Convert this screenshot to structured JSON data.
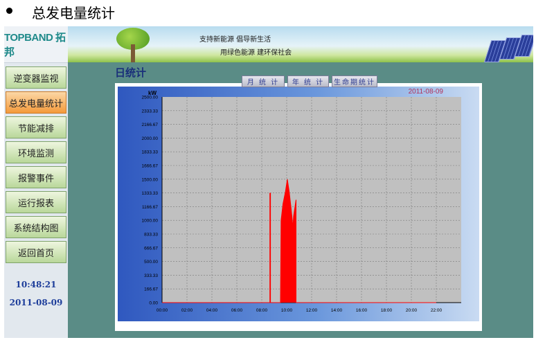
{
  "heading": {
    "bullet": "●",
    "text": "总发电量统计"
  },
  "logo": {
    "text": "TOPBAND 拓邦"
  },
  "banner": {
    "line1": "支持新能源   倡导新生活",
    "line2": "用绿色能源  建环保社会"
  },
  "nav": [
    {
      "label": "逆变器监视",
      "active": false
    },
    {
      "label": "总发电量统计",
      "active": true
    },
    {
      "label": "节能减排",
      "active": false
    },
    {
      "label": "环境监测",
      "active": false
    },
    {
      "label": "报警事件",
      "active": false
    },
    {
      "label": "运行报表",
      "active": false
    },
    {
      "label": "系统结构图",
      "active": false
    },
    {
      "label": "返回首页",
      "active": false
    }
  ],
  "clock": {
    "time": "10:48:21",
    "date": "2011-08-09"
  },
  "content": {
    "title": "日统计",
    "tabs": [
      "月 统 计",
      "年 统 计",
      "生命期统计"
    ],
    "chart_date": "2011-08-09"
  },
  "colors": {
    "series": "#ff0000",
    "plot_bg": "#c0c0c0",
    "grid": "#7a7a7a",
    "active_nav": "#f49a3b"
  },
  "chart_data": {
    "type": "area",
    "ylabel": "kW",
    "ylim": [
      0,
      2500
    ],
    "xlim": [
      0,
      24
    ],
    "y_ticks": [
      "2500.00",
      "2333.33",
      "2166.67",
      "2000.00",
      "1833.33",
      "1666.67",
      "1500.00",
      "1333.33",
      "1166.67",
      "1000.00",
      "833.33",
      "666.67",
      "500.00",
      "333.33",
      "166.67",
      "0.00"
    ],
    "x_ticks": [
      "00:00",
      "02:00",
      "04:00",
      "06:00",
      "08:00",
      "10:00",
      "12:00",
      "14:00",
      "16:00",
      "18:00",
      "20:00",
      "22:00"
    ],
    "grid": true,
    "series": [
      {
        "color": "#ff0000",
        "x": [
          0,
          8.65,
          8.65,
          8.7,
          8.7,
          9.5,
          9.55,
          9.7,
          9.9,
          10.05,
          10.2,
          10.35,
          10.45,
          10.5,
          10.55,
          10.6,
          10.7,
          10.75,
          10.75,
          22
        ],
        "y": [
          0,
          0,
          1330,
          1330,
          0,
          0,
          1000,
          1200,
          1350,
          1500,
          1350,
          1150,
          1000,
          900,
          1050,
          1100,
          1200,
          1250,
          0,
          0
        ]
      }
    ]
  }
}
